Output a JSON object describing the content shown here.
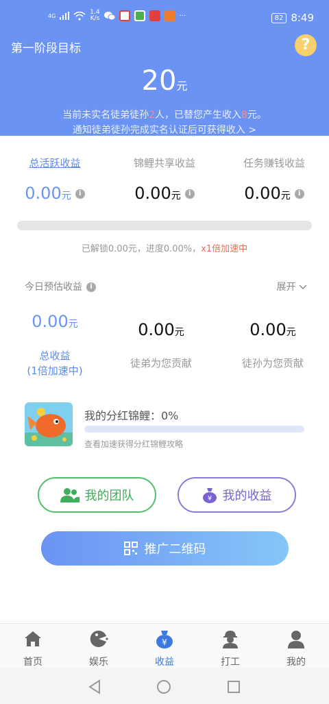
{
  "status_bar": {
    "network": "4G",
    "speed": "1.4",
    "speed_unit": "K/s",
    "battery": "82",
    "time": "8:49",
    "more": "···"
  },
  "header": {
    "title": "第一阶段目标",
    "help": "?",
    "amount": "20",
    "amount_unit": "元",
    "notice_pre": "当前未实名徒弟徒孙",
    "notice_count": "2",
    "notice_mid": "人，已替您产生收入",
    "notice_amount": "8",
    "notice_post": "元。",
    "notice_line2": "通知徒弟徒孙完成实名认证后可获得收入 >"
  },
  "earnings": {
    "tabs": [
      {
        "label": "总活跃收益",
        "value": "0.00",
        "unit": "元"
      },
      {
        "label": "锦鲤共享收益",
        "value": "0.00",
        "unit": "元"
      },
      {
        "label": "任务赚钱收益",
        "value": "0.00",
        "unit": "元"
      }
    ],
    "info_glyph": "i",
    "progress": 0.0,
    "unlock_text": "已解锁0.00元，进度0.00%，",
    "accel_text": "x1倍加速中"
  },
  "today": {
    "label": "今日预估收益",
    "expand": "展开",
    "items": [
      {
        "value": "0.00",
        "unit": "元",
        "label": "总收益",
        "label2": "(1倍加速中)"
      },
      {
        "value": "0.00",
        "unit": "元",
        "label": "徒弟为您贡献"
      },
      {
        "value": "0.00",
        "unit": "元",
        "label": "徒孙为您贡献"
      }
    ]
  },
  "koi": {
    "title": "我的分红锦鲤：0%",
    "progress": 0.0,
    "tip": "查看加速获得分红锦鲤攻略"
  },
  "actions": {
    "team": "我的团队",
    "income": "我的收益",
    "qr": "推广二维码"
  },
  "nav": {
    "items": [
      "首页",
      "娱乐",
      "收益",
      "打工",
      "我的"
    ],
    "active": 2
  },
  "colors": {
    "primary": "#6b93f3",
    "accent_red": "#ef6a4f",
    "green": "#4fbf6b",
    "purple": "#8d7ad8"
  }
}
